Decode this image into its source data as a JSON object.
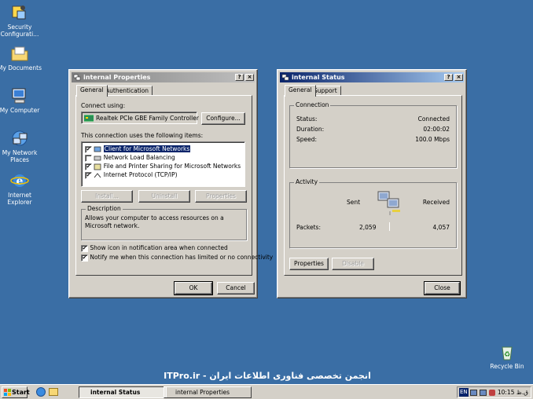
{
  "desktop": {
    "icons": [
      {
        "label_1": "Security",
        "label_2": "Configurati..."
      },
      {
        "label_1": "My Documents",
        "label_2": ""
      },
      {
        "label_1": "My Computer",
        "label_2": ""
      },
      {
        "label_1": "My Network",
        "label_2": "Places"
      },
      {
        "label_1": "Internet",
        "label_2": "Explorer"
      },
      {
        "label_1": "Recycle Bin",
        "label_2": ""
      }
    ],
    "watermark": "ITPro.ir - انجمن تخصصی فناوری اطلاعات ایران"
  },
  "props": {
    "title": "internal Properties",
    "help_btn": "?",
    "close_btn": "×",
    "tabs": [
      "General",
      "Authentication"
    ],
    "connect_using_label": "Connect using:",
    "adapter_name": "Realtek PCIe GBE Family Controller",
    "configure_btn": "Configure...",
    "items_label": "This connection uses the following items:",
    "items": [
      {
        "label": "Client for Microsoft Networks",
        "checked": "✔"
      },
      {
        "label": "Network Load Balancing",
        "checked": ""
      },
      {
        "label": "File and Printer Sharing for Microsoft Networks",
        "checked": "✔"
      },
      {
        "label": "Internet Protocol (TCP/IP)",
        "checked": "✔"
      }
    ],
    "install_btn": "Install...",
    "uninstall_btn": "Uninstall",
    "properties_btn": "Properties",
    "description_title": "Description",
    "description_text": "Allows your computer to access resources on a Microsoft network.",
    "show_icon_label": "Show icon in notification area when connected",
    "notify_label": "Notify me when this connection has limited or no connectivity",
    "show_icon_checked": "✔",
    "notify_checked": "✔",
    "ok_btn": "OK",
    "cancel_btn": "Cancel"
  },
  "status": {
    "title": "internal Status",
    "help_btn": "?",
    "close_btn": "×",
    "tabs": [
      "General",
      "Support"
    ],
    "connection_title": "Connection",
    "status_label": "Status:",
    "status_value": "Connected",
    "duration_label": "Duration:",
    "duration_value": "02:00:02",
    "speed_label": "Speed:",
    "speed_value": "100.0 Mbps",
    "activity_title": "Activity",
    "sent_label": "Sent",
    "received_label": "Received",
    "packets_label": "Packets:",
    "packets_sent": "2,059",
    "packets_received": "4,057",
    "properties_btn": "Properties",
    "disable_btn": "Disable",
    "close_button_label": "Close"
  },
  "taskbar": {
    "start_label": "Start",
    "tasks": [
      "internal Status",
      "internal Properties"
    ],
    "tray_lang": "EN",
    "clock": "10:15 ق.ظ"
  },
  "colors": {
    "desktop": "#3a6ea5",
    "title_active": "#0a246a",
    "title_inactive": "#808080",
    "face": "#d4d0c8"
  }
}
